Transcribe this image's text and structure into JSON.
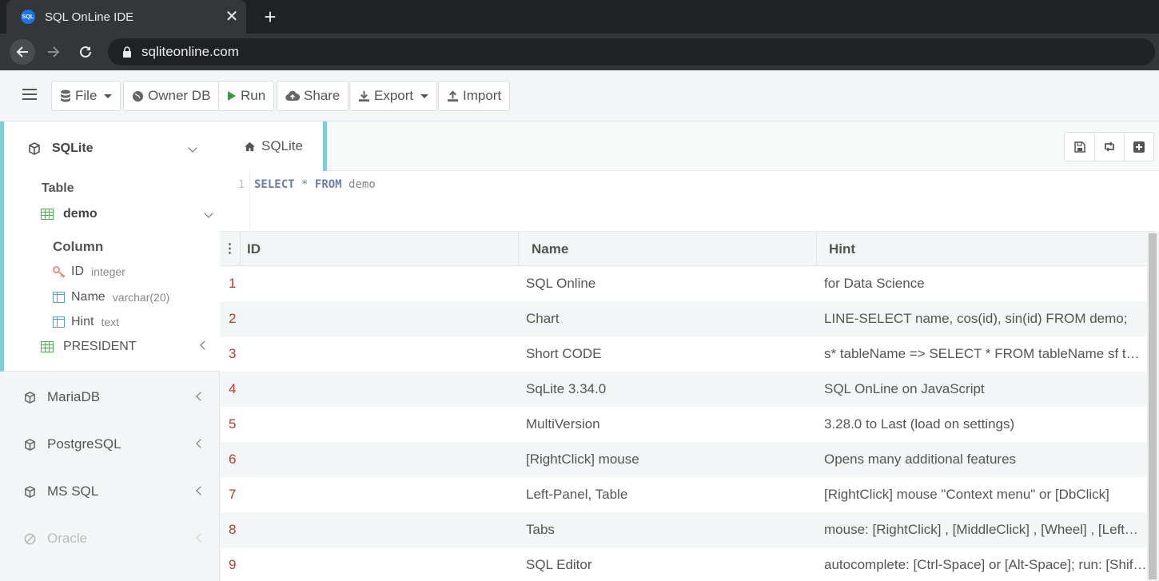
{
  "browser": {
    "tab_title": "SQL OnLine IDE",
    "favicon_text": "SQL",
    "url": "sqliteonline.com"
  },
  "toolbar": {
    "file": "File",
    "owner_db": "Owner DB",
    "run": "Run",
    "share": "Share",
    "export": "Export",
    "import": "Import"
  },
  "sidebar": {
    "active_db": "SQLite",
    "table_heading": "Table",
    "table_name": "demo",
    "column_heading": "Column",
    "columns": [
      {
        "name": "ID",
        "type": "integer"
      },
      {
        "name": "Name",
        "type": "varchar(20)"
      },
      {
        "name": "Hint",
        "type": "text"
      }
    ],
    "other_table": "PRESIDENT",
    "databases": [
      "MariaDB",
      "PostgreSQL",
      "MS SQL",
      "Oracle"
    ]
  },
  "editor": {
    "tab_label": "SQLite",
    "line_number": "1",
    "code": {
      "kw1": "SELECT",
      "star": "*",
      "kw2": "FROM",
      "table": "demo"
    }
  },
  "results": {
    "headers": [
      "ID",
      "Name",
      "Hint"
    ],
    "rows": [
      {
        "id": "1",
        "name": "SQL Online",
        "hint": "for Data Science"
      },
      {
        "id": "2",
        "name": "Chart",
        "hint": "LINE-SELECT name, cos(id), sin(id) FROM demo;"
      },
      {
        "id": "3",
        "name": "Short CODE",
        "hint": "s* tableName => SELECT * FROM tableName sf tableName"
      },
      {
        "id": "4",
        "name": "SqLite 3.34.0",
        "hint": "SQL OnLine on JavaScript"
      },
      {
        "id": "5",
        "name": "MultiVersion",
        "hint": "3.28.0 to Last (load on settings)"
      },
      {
        "id": "6",
        "name": "[RightClick] mouse",
        "hint": "Opens many additional features"
      },
      {
        "id": "7",
        "name": "Left-Panel, Table",
        "hint": "[RightClick] mouse \"Context menu\" or [DbClick]"
      },
      {
        "id": "8",
        "name": "Tabs",
        "hint": "mouse: [RightClick] , [MiddleClick] , [Wheel] , [LeftClick]"
      },
      {
        "id": "9",
        "name": "SQL Editor",
        "hint": "autocomplete: [Ctrl-Space] or [Alt-Space]; run: [Shift-Enter]"
      }
    ]
  },
  "colors": {
    "accent": "#7ecdd3",
    "id_text": "#c0392b",
    "panel_bg": "#f3f6f6"
  }
}
